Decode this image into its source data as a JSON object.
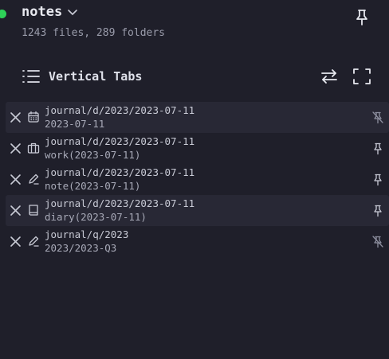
{
  "vault": {
    "name": "notes",
    "stats": "1243 files, 289 folders"
  },
  "section": {
    "title": "Vertical Tabs"
  },
  "tabs": [
    {
      "path": "journal/d/2023/2023-07-11",
      "name": "2023-07-11",
      "icon": "calendar-icon",
      "pin": "pin-off-icon"
    },
    {
      "path": "journal/d/2023/2023-07-11",
      "name": "work(2023-07-11)",
      "icon": "briefcase-icon",
      "pin": "pin-icon"
    },
    {
      "path": "journal/d/2023/2023-07-11",
      "name": "note(2023-07-11)",
      "icon": "pencil-icon",
      "pin": "pin-icon"
    },
    {
      "path": "journal/d/2023/2023-07-11",
      "name": "diary(2023-07-11)",
      "icon": "book-icon",
      "pin": "pin-icon"
    },
    {
      "path": "journal/q/2023",
      "name": "2023/2023-Q3",
      "icon": "pencil-icon",
      "pin": "pin-off-icon"
    }
  ],
  "colors": {
    "background": "#1f1f2a",
    "status_dot": "#2ed158",
    "row_highlight": "#282835",
    "icon": "#c9cbd6"
  }
}
